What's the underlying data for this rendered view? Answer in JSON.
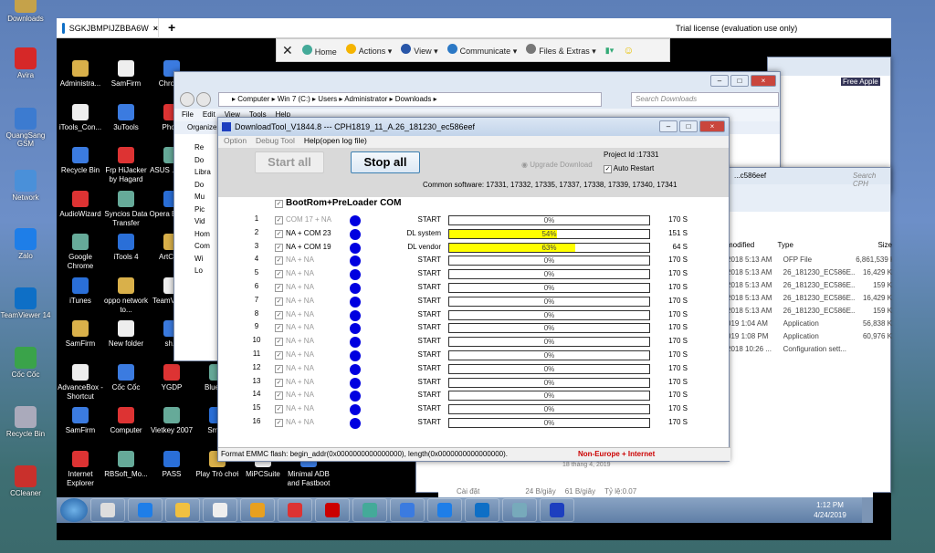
{
  "outer_desktop": {
    "icons": [
      "Downloads",
      "Avira",
      "QuangSang GSM",
      "Network",
      "Zalo",
      "TeamViewer 14",
      "Cốc Cốc",
      "Recycle Bin",
      "CCleaner"
    ]
  },
  "teamviewer": {
    "tab_label": "SGKJBMPIJZBBA6W",
    "license": "Trial license (evaluation use only)",
    "toolbar": [
      "Home",
      "Actions",
      "View",
      "Communicate",
      "Files & Extras"
    ]
  },
  "remote_desktop": {
    "icons": [
      [
        "Administra...",
        "SamFirm",
        "Chrome"
      ],
      [
        "iTools_Con...",
        "3uTools",
        "Pho..."
      ],
      [
        "Recycle Bin",
        "Frp HiJacker by Hagard",
        "ASUS ... To..."
      ],
      [
        "AudioWizard",
        "Syncios Data Transfer",
        "Opera Brow..."
      ],
      [
        "Google Chrome",
        "iTools 4",
        "ArtCAM"
      ],
      [
        "iTunes",
        "oppo network to...",
        "TeamV... 14"
      ],
      [
        "SamFirm",
        "New folder",
        "sh..."
      ],
      [
        "AdvanceBox - Shortcut",
        "Cốc Cốc",
        "YGDP",
        "BlueS..."
      ],
      [
        "SamFirm",
        "Computer",
        "Vietkey 2007",
        "Smart"
      ],
      [
        "Internet Explorer",
        "RBSoft_Mo...",
        "PASS",
        "Play Trò chơi",
        "MiPCSuite",
        "Minimal ADB and Fastboot"
      ]
    ]
  },
  "explorer": {
    "breadcrumb": [
      "Computer",
      "Win 7 (C:)",
      "Users",
      "Administrator",
      "Downloads"
    ],
    "search_placeholder": "Search Downloads",
    "menu": [
      "File",
      "Edit",
      "View",
      "Tools",
      "Help"
    ],
    "organize": "Organize",
    "nav": [
      "Re",
      "Do",
      "Libra",
      "Do",
      "Mu",
      "Pic",
      "Vid",
      "Hom",
      "Com",
      "Wi",
      "Lo"
    ]
  },
  "explorer2": {
    "path": "...c586eef",
    "search_placeholder": "Search CPH",
    "columns": [
      "modified",
      "Type",
      "Size"
    ],
    "rows": [
      [
        "2018 5:13 AM",
        "OFP File",
        "6,861,539 K"
      ],
      [
        "2018 5:13 AM",
        "26_181230_EC586E...",
        "16,429 K"
      ],
      [
        "2018 5:13 AM",
        "26_181230_EC586E...",
        "159 K"
      ],
      [
        "2018 5:13 AM",
        "26_181230_EC586E...",
        "16,429 K"
      ],
      [
        "2018 5:13 AM",
        "26_181230_EC586E...",
        "159 K"
      ],
      [
        "019 1:04 AM",
        "Application",
        "56,838 K"
      ],
      [
        "019 1:08 PM",
        "Application",
        "60,976 K"
      ],
      [
        "2018 10:26 ...",
        "Configuration sett...",
        ""
      ]
    ]
  },
  "top_right_window": {
    "label": "Free Apple"
  },
  "download_tool": {
    "title": "DownloadTool_V1844.8   ---   CPH1819_11_A.26_181230_ec586eef",
    "menu": [
      "Option",
      "Debug Tool",
      "Help(open log file)"
    ],
    "start_all": "Start all",
    "stop_all": "Stop all",
    "upgrade_download": "Upgrade Download",
    "project_id": "Project Id :17331",
    "auto_restart": "Auto Restart",
    "auto_restart_checked": true,
    "common_software": "Common software: 17331, 17332, 17335, 17337, 17338, 17339, 17340, 17341",
    "bootrom_label": "BootRom+PreLoader COM",
    "ports": [
      {
        "n": "1",
        "label": "COM 17 + NA",
        "status": "START",
        "progress": 0,
        "pct": "0%",
        "time": "170 S"
      },
      {
        "n": "2",
        "label": "NA + COM 23",
        "status": "DL system",
        "progress": 54,
        "pct": "54%",
        "time": "151 S"
      },
      {
        "n": "3",
        "label": "NA + COM 19",
        "status": "DL vendor",
        "progress": 63,
        "pct": "63%",
        "time": "64 S"
      },
      {
        "n": "4",
        "label": "NA + NA",
        "status": "START",
        "progress": 0,
        "pct": "0%",
        "time": "170 S"
      },
      {
        "n": "5",
        "label": "NA + NA",
        "status": "START",
        "progress": 0,
        "pct": "0%",
        "time": "170 S"
      },
      {
        "n": "6",
        "label": "NA + NA",
        "status": "START",
        "progress": 0,
        "pct": "0%",
        "time": "170 S"
      },
      {
        "n": "7",
        "label": "NA + NA",
        "status": "START",
        "progress": 0,
        "pct": "0%",
        "time": "170 S"
      },
      {
        "n": "8",
        "label": "NA + NA",
        "status": "START",
        "progress": 0,
        "pct": "0%",
        "time": "170 S"
      },
      {
        "n": "9",
        "label": "NA + NA",
        "status": "START",
        "progress": 0,
        "pct": "0%",
        "time": "170 S"
      },
      {
        "n": "10",
        "label": "NA + NA",
        "status": "START",
        "progress": 0,
        "pct": "0%",
        "time": "170 S"
      },
      {
        "n": "11",
        "label": "NA + NA",
        "status": "START",
        "progress": 0,
        "pct": "0%",
        "time": "170 S"
      },
      {
        "n": "12",
        "label": "NA + NA",
        "status": "START",
        "progress": 0,
        "pct": "0%",
        "time": "170 S"
      },
      {
        "n": "13",
        "label": "NA + NA",
        "status": "START",
        "progress": 0,
        "pct": "0%",
        "time": "170 S"
      },
      {
        "n": "14",
        "label": "NA + NA",
        "status": "START",
        "progress": 0,
        "pct": "0%",
        "time": "170 S"
      },
      {
        "n": "15",
        "label": "NA + NA",
        "status": "START",
        "progress": 0,
        "pct": "0%",
        "time": "170 S"
      },
      {
        "n": "16",
        "label": "NA + NA",
        "status": "START",
        "progress": 0,
        "pct": "0%",
        "time": "170 S"
      }
    ],
    "status_text": "Format EMMC flash:  begin_addr(0x0000000000000000), length(0x0000000000000000).",
    "region": "Non-Europe +  Internet",
    "colors": {
      "progress": "#ffff00",
      "dot": "#0000e0",
      "region": "#cc0000"
    }
  },
  "bg_app": {
    "settings": "Cài đặt",
    "down": "24 B/giây",
    "up": "61 B/giây",
    "ratio": "Tỷ lệ:0.07",
    "date": "18 tháng 4, 2019"
  },
  "taskbar": {
    "time": "1:12 PM",
    "date": "4/24/2019",
    "zalo_badge": "2"
  }
}
